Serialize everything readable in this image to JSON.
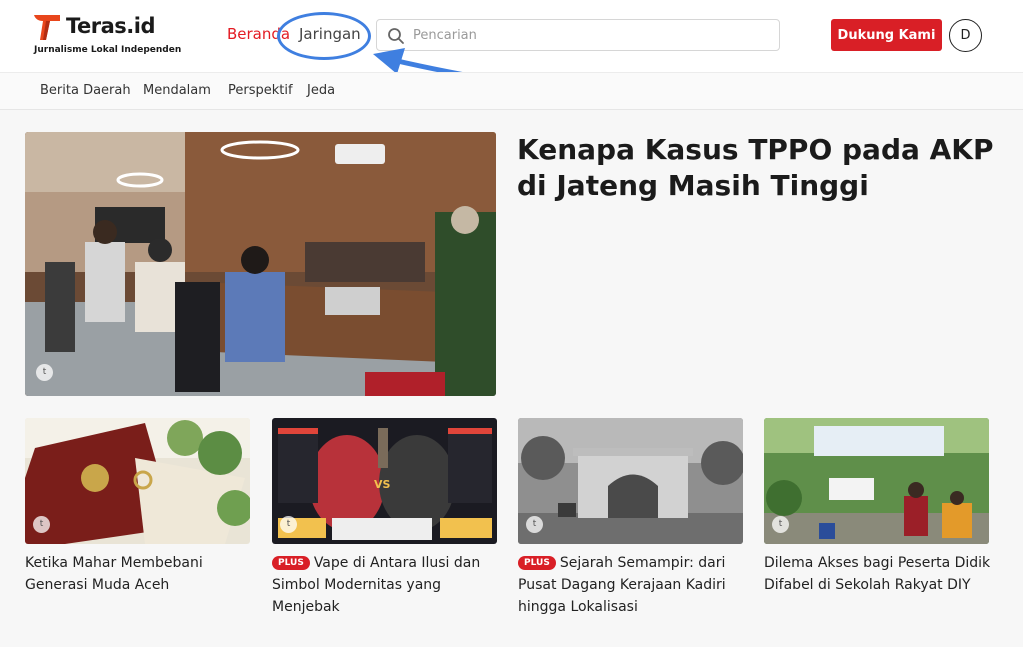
{
  "header": {
    "logo_name": "Teras.id",
    "logo_tagline": "Jurnalisme Lokal Independen",
    "nav": [
      {
        "label": "Beranda",
        "active": true
      },
      {
        "label": "Jaringan",
        "active": false
      }
    ],
    "search_placeholder": "Pencarian",
    "support_button": "Dukung Kami",
    "avatar_initial": "D"
  },
  "subnav": [
    "Berita Daerah",
    "Mendalam",
    "Perspektif",
    "Jeda"
  ],
  "hero": {
    "title": "Kenapa Kasus TPPO pada AKP di Jateng Masih Tinggi",
    "badge": "t"
  },
  "cards": [
    {
      "title": "Ketika Mahar Membebani Generasi Muda Aceh",
      "plus": false,
      "badge": "t"
    },
    {
      "title": "Vape di Antara Ilusi dan Simbol Modernitas yang Menjebak",
      "plus": true,
      "plus_label": "PLUS",
      "badge": "t",
      "image_text": "VS"
    },
    {
      "title": "Sejarah Semampir: dari Pusat Dagang Kerajaan Kadiri hingga Lokalisasi",
      "plus": true,
      "plus_label": "PLUS",
      "badge": "t"
    },
    {
      "title": "Dilema Akses bagi Peserta Didik Difabel di Sekolah Rakyat DIY",
      "plus": false,
      "badge": "t"
    }
  ],
  "colors": {
    "brand_red": "#d91f26",
    "annotation_blue": "#3f7fe0"
  }
}
